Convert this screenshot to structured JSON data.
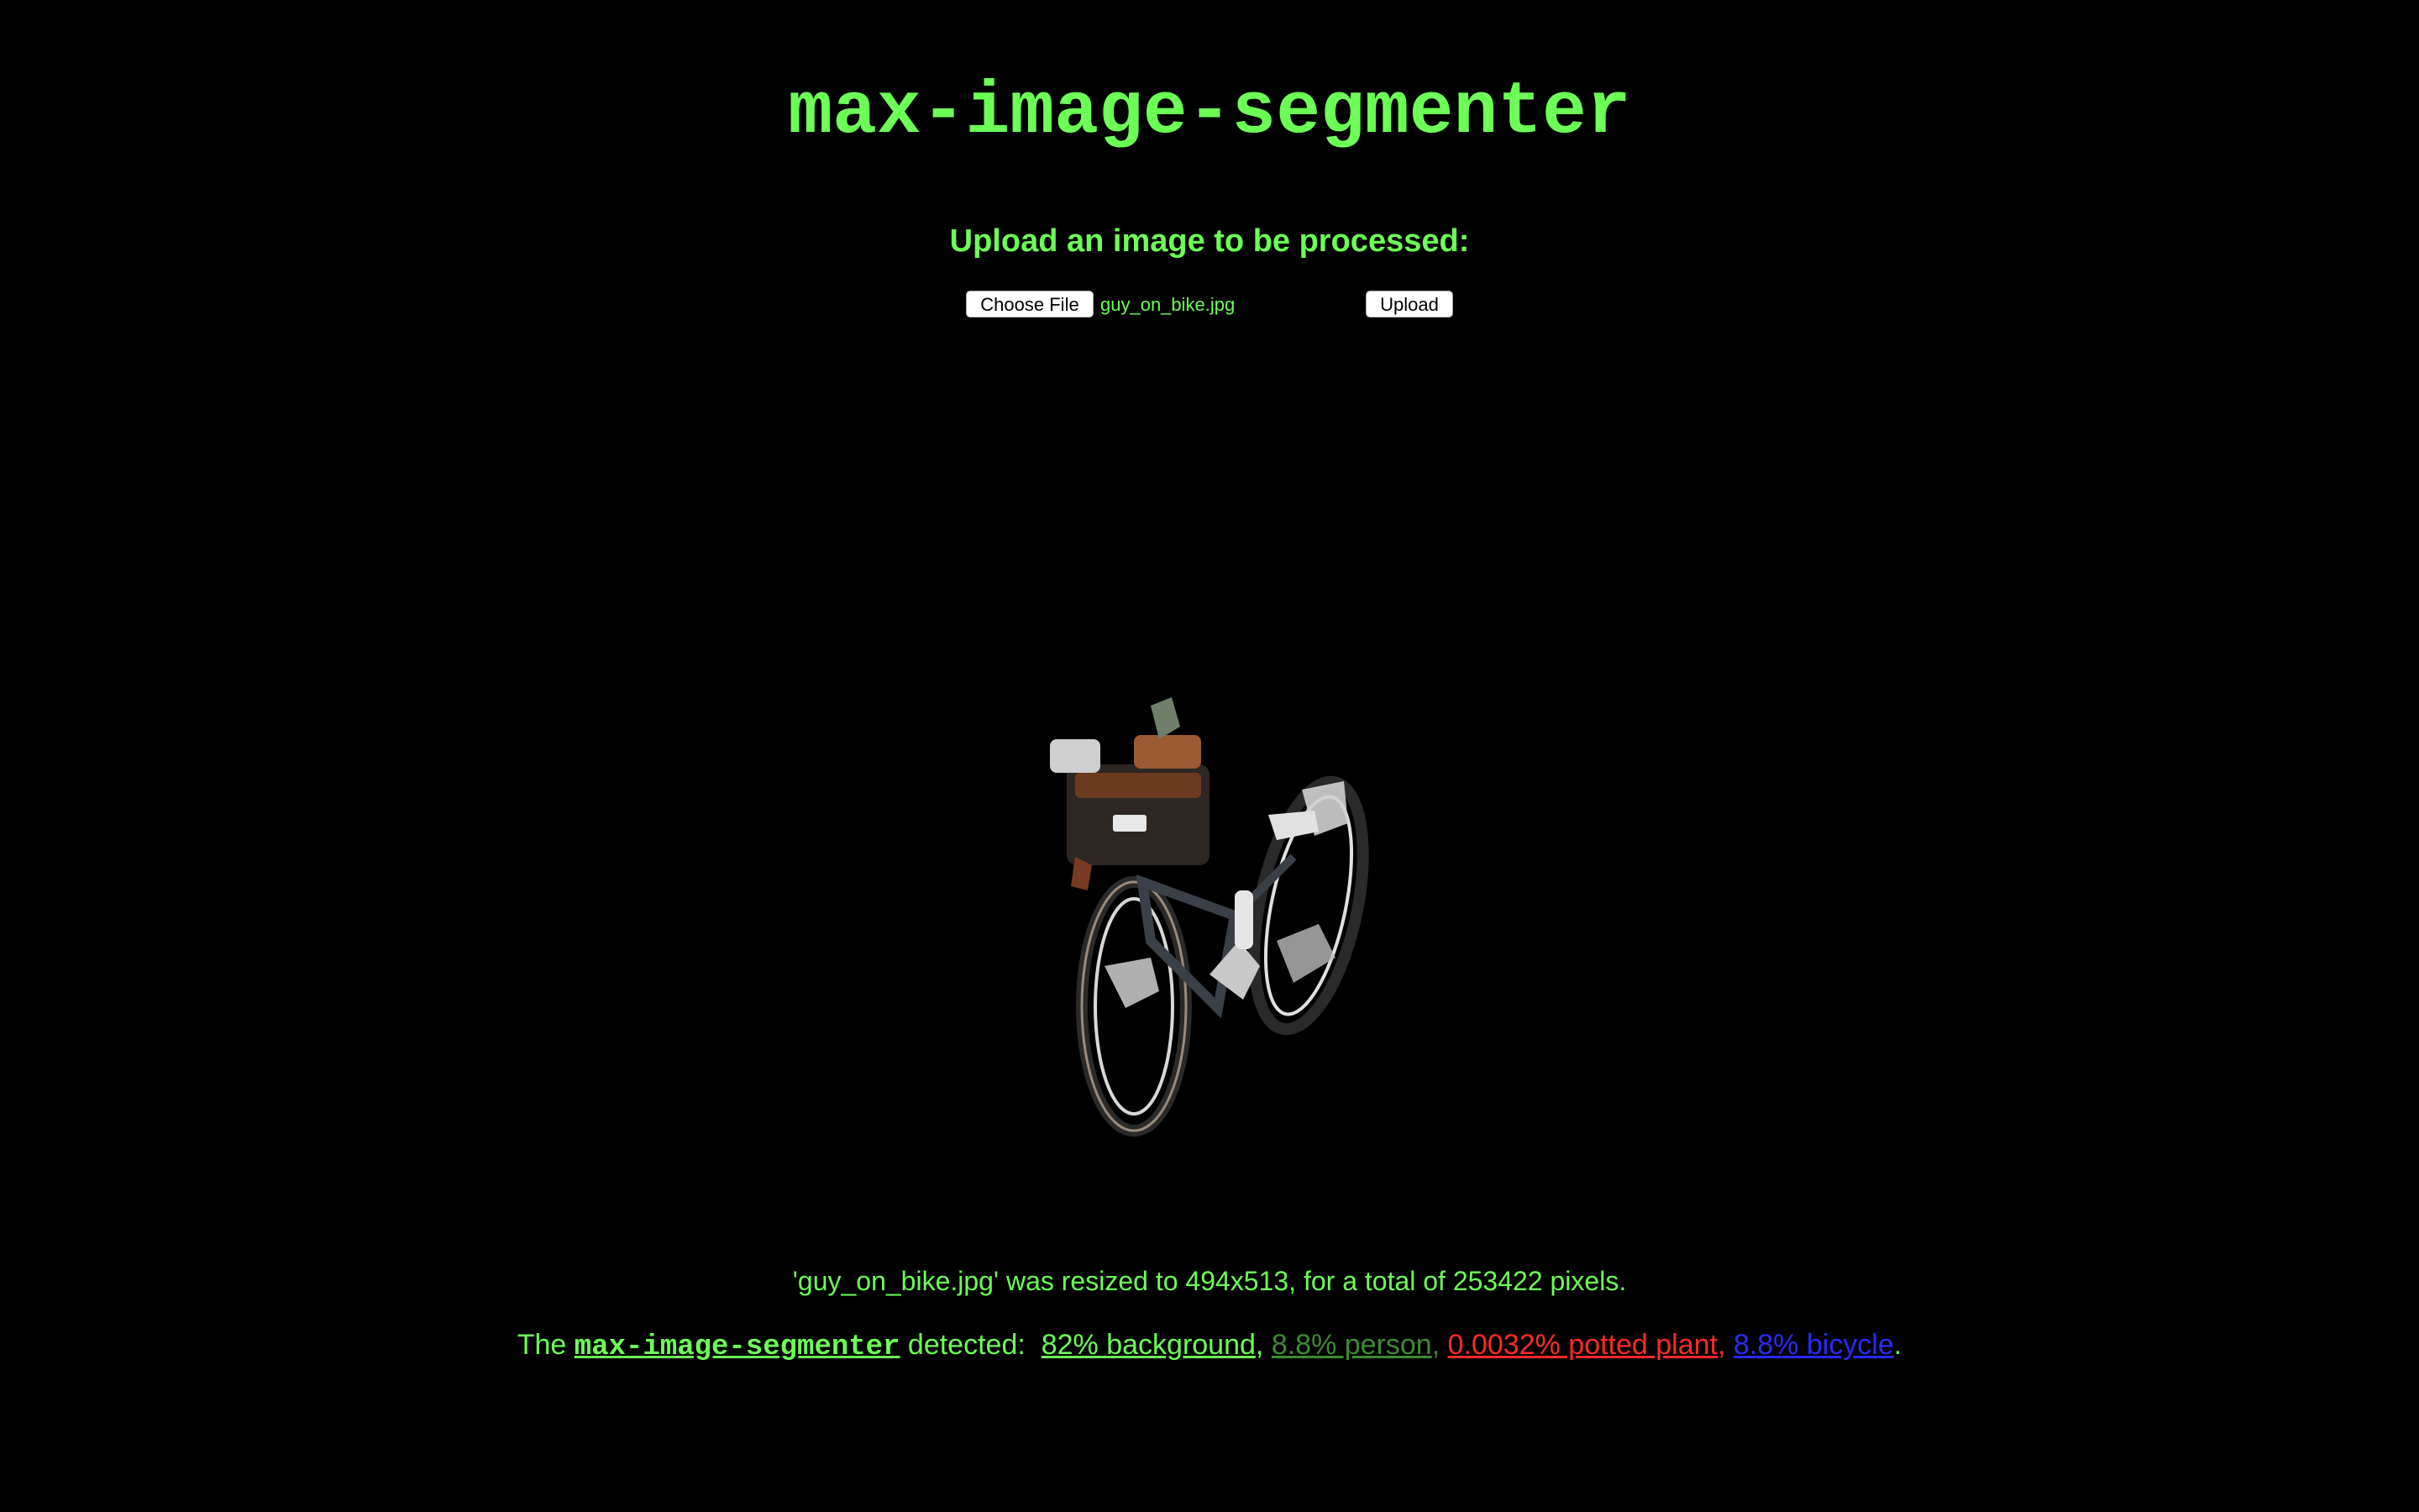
{
  "header": {
    "title": "max-image-segmenter"
  },
  "upload_form": {
    "heading": "Upload an image to be processed:",
    "choose_file_label": "Choose File",
    "selected_file": "guy_on_bike.jpg",
    "upload_label": "Upload"
  },
  "result_image": {
    "description_icon": "segmented-bicycle-image"
  },
  "results": {
    "resize_message": "'guy_on_bike.jpg' was resized to 494x513, for a total of 253422 pixels.",
    "detect_prefix": "The",
    "model_name": "max-image-segmenter",
    "detect_middle": "detected:",
    "segments": [
      {
        "label": "82% background",
        "color": "#6cff56",
        "separator": ","
      },
      {
        "label": "8.8% person",
        "color": "#3f8a35",
        "separator": ","
      },
      {
        "label": "0.0032% potted plant",
        "color": "#ff2a2a",
        "separator": ","
      },
      {
        "label": "8.8% bicycle",
        "color": "#2a2aff",
        "separator": "."
      }
    ]
  },
  "colors": {
    "background": "#000000",
    "accent": "#6cff56"
  }
}
